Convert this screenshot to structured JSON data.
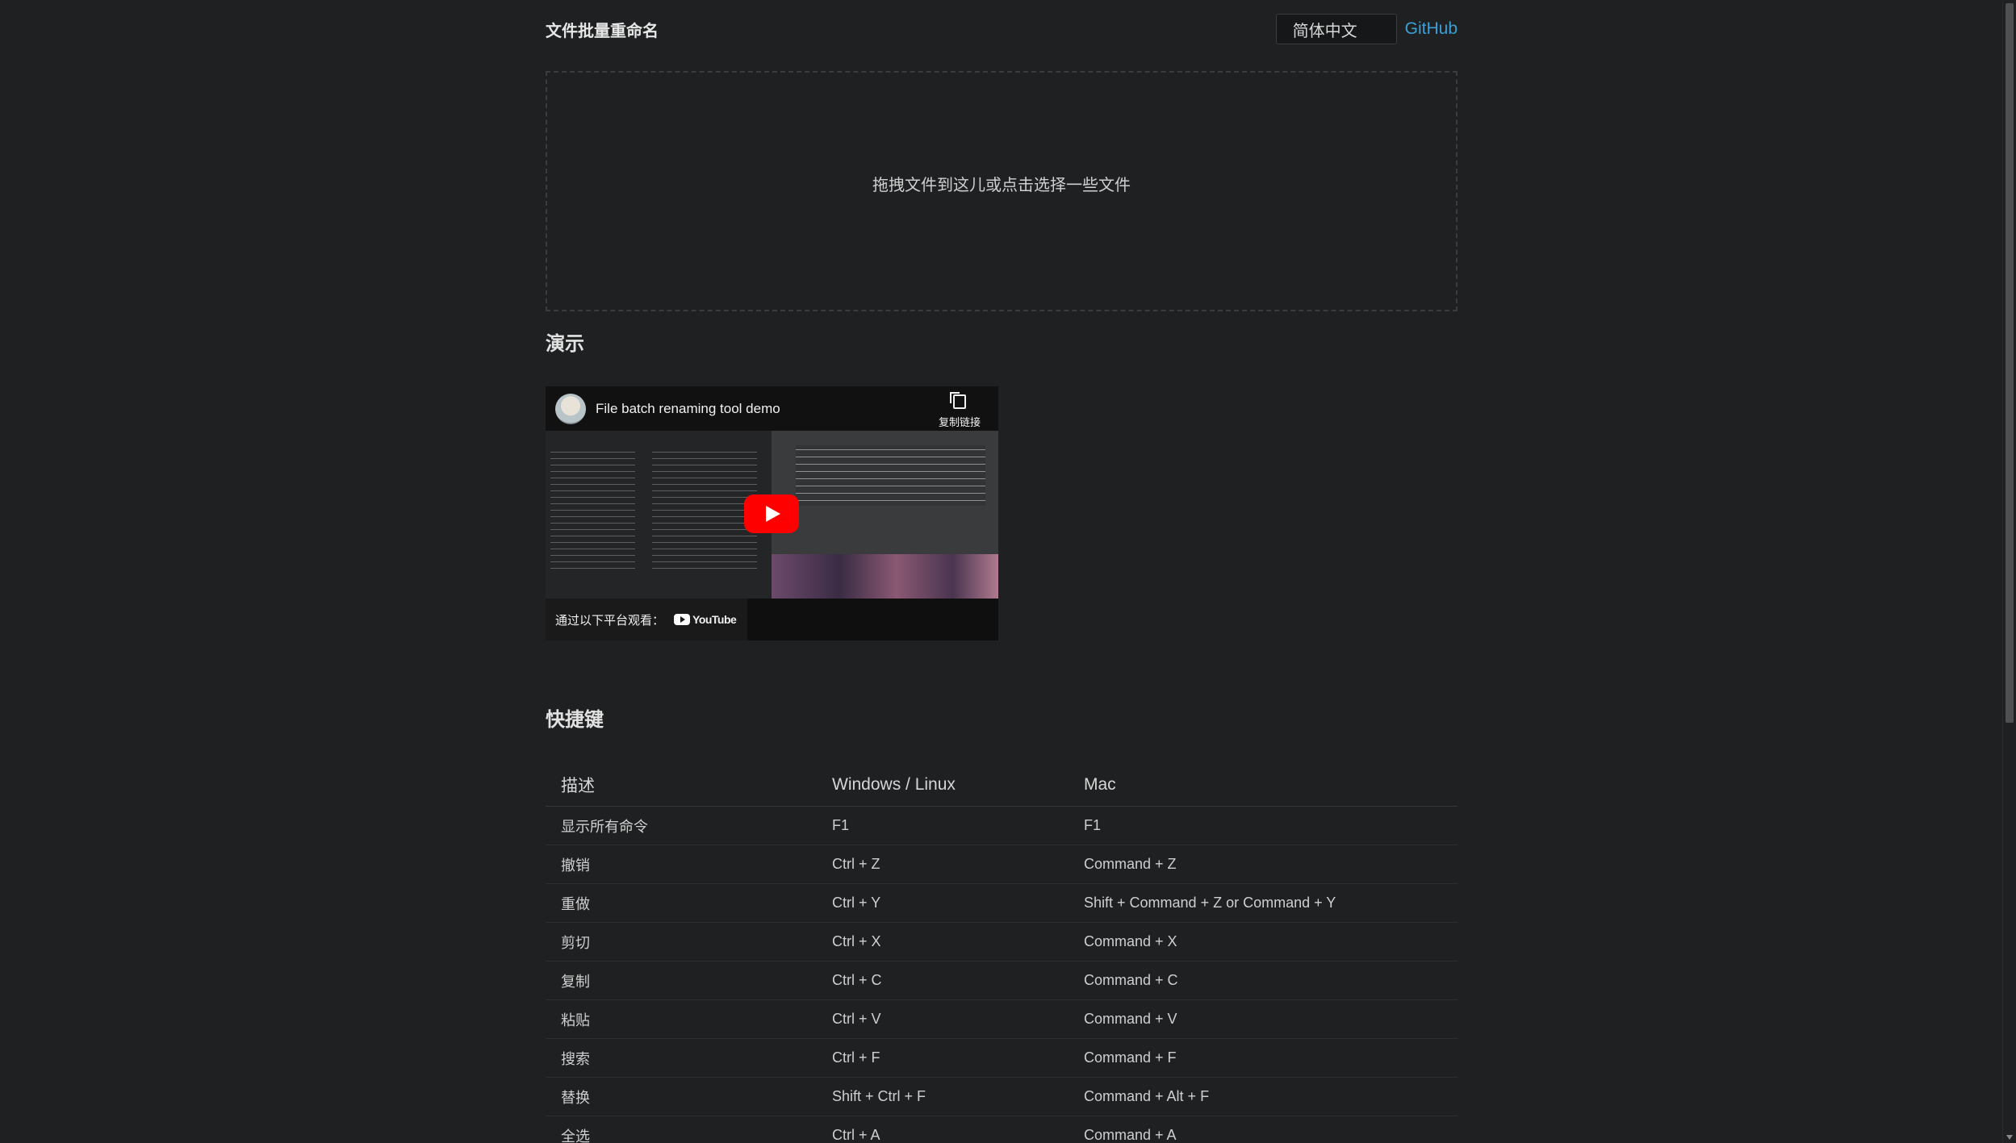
{
  "header": {
    "title": "文件批量重命名",
    "language": "简体中文",
    "github": "GitHub"
  },
  "dropzone": {
    "text": "拖拽文件到这儿或点击选择一些文件"
  },
  "demo": {
    "title": "演示",
    "video": {
      "title": "File batch renaming tool demo",
      "copy_link": "复制链接",
      "watch_on": "通过以下平台观看：",
      "platform": "YouTube"
    }
  },
  "shortcuts": {
    "title": "快捷键",
    "headers": [
      "描述",
      "Windows / Linux",
      "Mac"
    ],
    "rows": [
      [
        "显示所有命令",
        "F1",
        "F1"
      ],
      [
        "撤销",
        "Ctrl + Z",
        "Command + Z"
      ],
      [
        "重做",
        "Ctrl + Y",
        "Shift + Command + Z or Command + Y"
      ],
      [
        "剪切",
        "Ctrl + X",
        "Command + X"
      ],
      [
        "复制",
        "Ctrl + C",
        "Command + C"
      ],
      [
        "粘贴",
        "Ctrl + V",
        "Command + V"
      ],
      [
        "搜索",
        "Ctrl + F",
        "Command + F"
      ],
      [
        "替换",
        "Shift + Ctrl + F",
        "Command + Alt + F"
      ],
      [
        "全选",
        "Ctrl + A",
        "Command + A"
      ]
    ]
  },
  "colors": {
    "background": "#1f2021",
    "link": "#3b9fd6",
    "play_button": "#ff0000"
  }
}
